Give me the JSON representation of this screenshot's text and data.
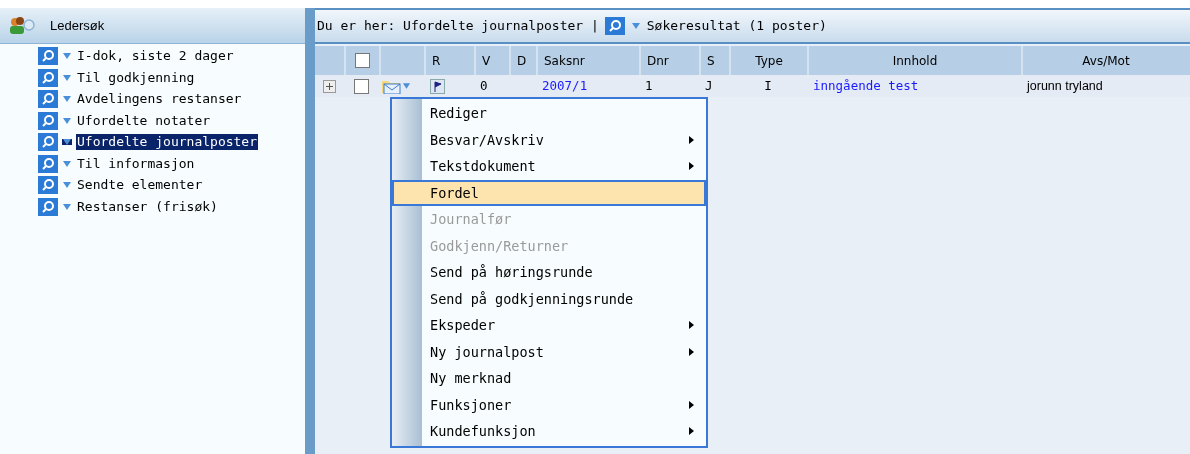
{
  "sidebar": {
    "title": "Ledersøk",
    "items": [
      {
        "label": "I-dok, siste 2 dager",
        "selected": false
      },
      {
        "label": "Til godkjenning",
        "selected": false
      },
      {
        "label": "Avdelingens restanser",
        "selected": false
      },
      {
        "label": "Ufordelte notater",
        "selected": false
      },
      {
        "label": "Ufordelte journalposter",
        "selected": true
      },
      {
        "label": "Til informasjon",
        "selected": false
      },
      {
        "label": "Sendte elementer",
        "selected": false
      },
      {
        "label": "Restanser (frisøk)",
        "selected": false
      }
    ]
  },
  "breadcrumb": {
    "location": "Du er her: Ufordelte journalposter |",
    "result": "Søkeresultat (1 poster)"
  },
  "table": {
    "all_checked": false,
    "columns": [
      "R",
      "V",
      "D",
      "Saksnr",
      "Dnr",
      "S",
      "Type",
      "Innhold",
      "Avs/Mot"
    ],
    "rows": [
      {
        "checked": false,
        "cells": [
          "",
          "0",
          "",
          "2007/1",
          "1",
          "J",
          "I",
          "inngående test",
          "jorunn tryland"
        ]
      }
    ]
  },
  "context_menu": {
    "items": [
      {
        "label": "Rediger",
        "submenu": false,
        "disabled": false,
        "selected": false
      },
      {
        "label": "Besvar/Avskriv",
        "submenu": true,
        "disabled": false,
        "selected": false
      },
      {
        "label": "Tekstdokument",
        "submenu": true,
        "disabled": false,
        "selected": false
      },
      {
        "label": "Fordel",
        "submenu": false,
        "disabled": false,
        "selected": true
      },
      {
        "label": "Journalfør",
        "submenu": false,
        "disabled": true,
        "selected": false
      },
      {
        "label": "Godkjenn/Returner",
        "submenu": false,
        "disabled": true,
        "selected": false
      },
      {
        "label": "Send på høringsrunde",
        "submenu": false,
        "disabled": false,
        "selected": false
      },
      {
        "label": "Send på godkjenningsrunde",
        "submenu": false,
        "disabled": false,
        "selected": false
      },
      {
        "label": "Ekspeder",
        "submenu": true,
        "disabled": false,
        "selected": false
      },
      {
        "label": "Ny journalpost",
        "submenu": true,
        "disabled": false,
        "selected": false
      },
      {
        "label": "Ny merknad",
        "submenu": false,
        "disabled": false,
        "selected": false
      },
      {
        "label": "Funksjoner",
        "submenu": true,
        "disabled": false,
        "selected": false
      },
      {
        "label": "Kundefunksjon",
        "submenu": true,
        "disabled": false,
        "selected": false
      }
    ]
  }
}
